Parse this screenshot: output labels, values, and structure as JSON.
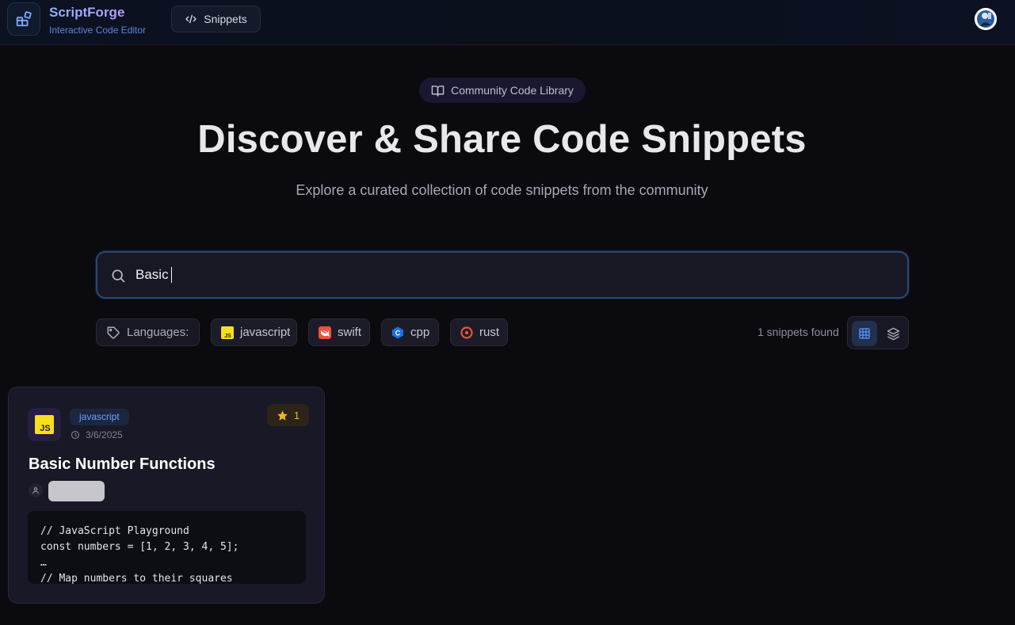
{
  "header": {
    "brand_title": "ScriptForge",
    "brand_subtitle": "Interactive Code Editor",
    "snippets_label": "Snippets"
  },
  "hero": {
    "pill_label": "Community Code Library",
    "title": "Discover & Share Code Snippets",
    "subtitle": "Explore a curated collection of code snippets from the community"
  },
  "search": {
    "value": "Basic",
    "placeholder": ""
  },
  "filters": {
    "label": "Languages:",
    "languages": [
      "javascript",
      "swift",
      "cpp",
      "rust"
    ]
  },
  "results": {
    "count_text": "1 snippets found",
    "view_modes": [
      "grid",
      "list"
    ],
    "active_view": "grid"
  },
  "snippet": {
    "language": "javascript",
    "logo_text": "JS",
    "date": "3/6/2025",
    "stars": "1",
    "title": "Basic Number Functions",
    "code_lines": [
      "// JavaScript Playground",
      "const numbers = [1, 2, 3, 4, 5];",
      "…",
      "// Map numbers to their squares"
    ]
  },
  "colors": {
    "accent": "#3b82f6",
    "javascript": "#f7df1e",
    "swift": "#f05138",
    "cpp": "#1f6feb",
    "rust": "#e5533b",
    "star": "#f0b429"
  }
}
